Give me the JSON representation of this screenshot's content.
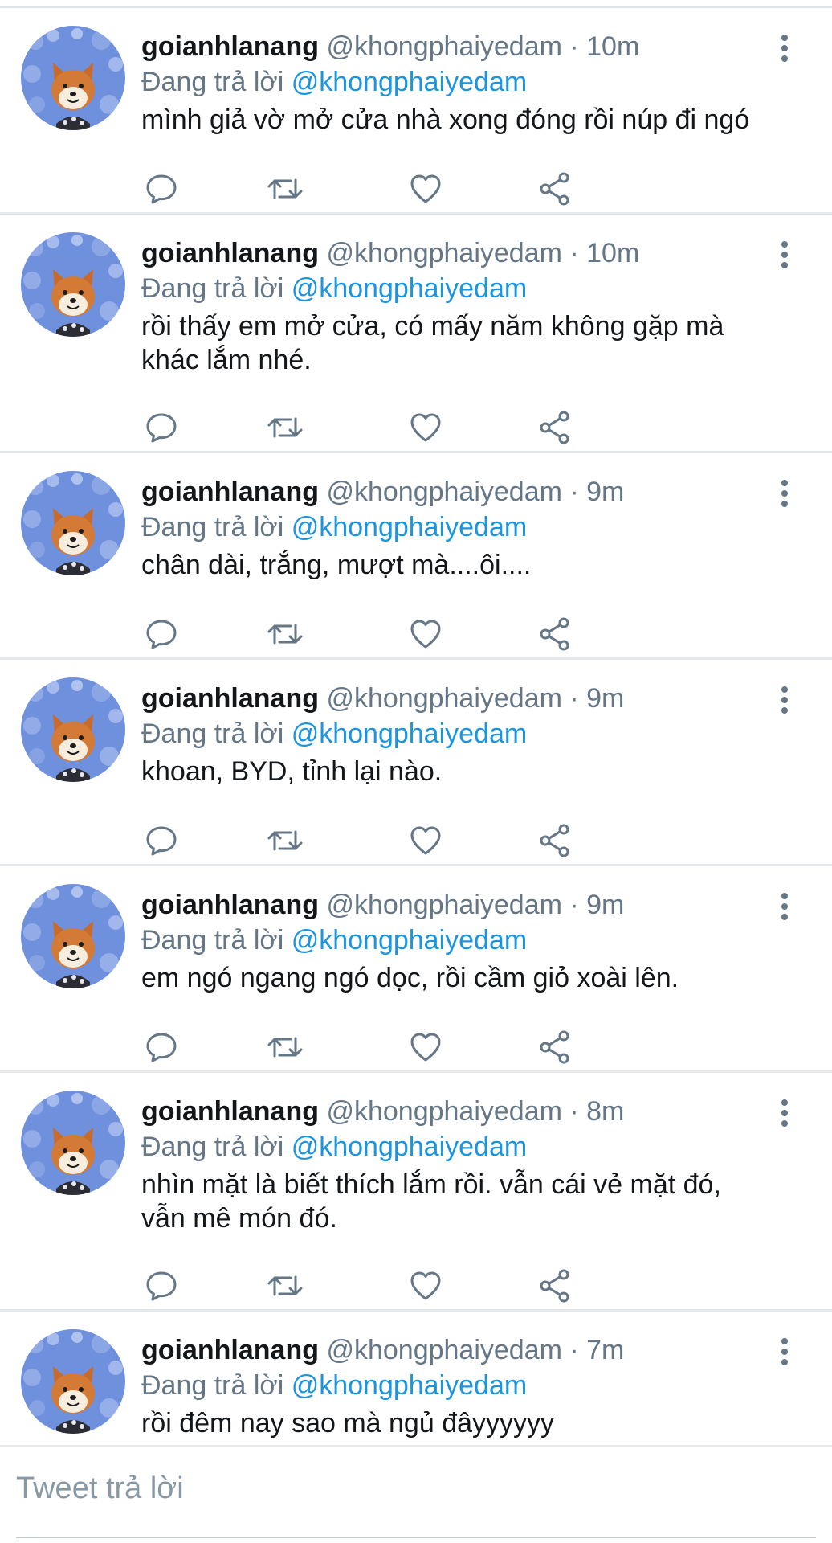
{
  "tweets": [
    {
      "display_name": "goianhlanang",
      "handle_time": "@khongphaiyedam · 10m",
      "reply_prefix": "Đang trả lời ",
      "reply_to": "@khongphaiyedam",
      "text": "mình giả vờ mở cửa nhà xong đóng rồi núp đi ngó"
    },
    {
      "display_name": "goianhlanang",
      "handle_time": "@khongphaiyedam · 10m",
      "reply_prefix": "Đang trả lời ",
      "reply_to": "@khongphaiyedam",
      "text": "rồi thấy em mở cửa, có mấy năm không gặp mà khác lắm nhé."
    },
    {
      "display_name": "goianhlanang",
      "handle_time": "@khongphaiyedam · 9m",
      "reply_prefix": "Đang trả lời ",
      "reply_to": "@khongphaiyedam",
      "text": "chân dài, trắng, mượt mà....ôi...."
    },
    {
      "display_name": "goianhlanang",
      "handle_time": "@khongphaiyedam · 9m",
      "reply_prefix": "Đang trả lời ",
      "reply_to": "@khongphaiyedam",
      "text": "khoan, BYD, tỉnh lại nào."
    },
    {
      "display_name": "goianhlanang",
      "handle_time": "@khongphaiyedam · 9m",
      "reply_prefix": "Đang trả lời ",
      "reply_to": "@khongphaiyedam",
      "text": "em ngó ngang ngó dọc, rồi cầm giỏ xoài lên."
    },
    {
      "display_name": "goianhlanang",
      "handle_time": "@khongphaiyedam · 8m",
      "reply_prefix": "Đang trả lời ",
      "reply_to": "@khongphaiyedam",
      "text": "nhìn mặt là biết thích lắm rồi. vẫn cái vẻ mặt đó, vẫn mê món đó."
    },
    {
      "display_name": "goianhlanang",
      "handle_time": "@khongphaiyedam · 7m",
      "reply_prefix": "Đang trả lời ",
      "reply_to": "@khongphaiyedam",
      "text": "rồi đêm nay sao mà ngủ đâyyyyyy"
    }
  ],
  "icons": {
    "reply": "reply-icon",
    "retweet": "retweet-icon",
    "like": "heart-icon",
    "share": "share-icon",
    "more": "more-vertical-icon",
    "avatar": "shiba-dog-avatar"
  },
  "compose": {
    "placeholder": "Tweet trả lời"
  },
  "colors": {
    "mention": "#1b95e0",
    "secondary_text": "#657786",
    "icon": "#657786",
    "divider": "#e6e9ec"
  }
}
